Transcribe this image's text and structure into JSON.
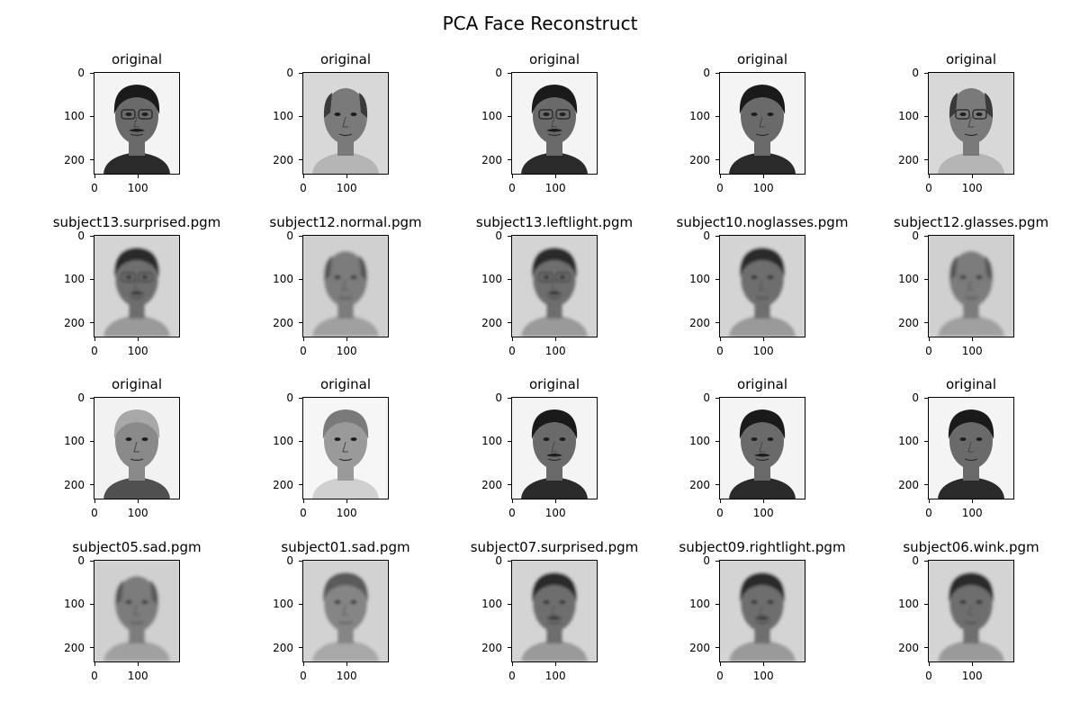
{
  "suptitle": "PCA Face Reconstruct",
  "chart_data": {
    "type": "image-grid",
    "title": "PCA Face Reconstruct",
    "rows": 4,
    "cols": 5,
    "x_ticks": [
      "0",
      "100"
    ],
    "y_ticks": [
      "0",
      "100",
      "200"
    ],
    "xlim": [
      0,
      195
    ],
    "ylim": [
      0,
      231
    ],
    "panels": [
      {
        "title": "original",
        "tone": "dark",
        "glasses": true,
        "mustache": true
      },
      {
        "title": "original",
        "tone": "bald",
        "glasses": false,
        "mustache": false
      },
      {
        "title": "original",
        "tone": "dark",
        "glasses": true,
        "mustache": true
      },
      {
        "title": "original",
        "tone": "dark",
        "glasses": false,
        "mustache": false
      },
      {
        "title": "original",
        "tone": "bald",
        "glasses": true,
        "mustache": false
      },
      {
        "title": "subject13.surprised.pgm",
        "tone": "recon-dark",
        "glasses": true,
        "mustache": true
      },
      {
        "title": "subject12.normal.pgm",
        "tone": "recon-bald",
        "glasses": false,
        "mustache": false
      },
      {
        "title": "subject13.leftlight.pgm",
        "tone": "recon-dark",
        "glasses": true,
        "mustache": true
      },
      {
        "title": "subject10.noglasses.pgm",
        "tone": "recon-dark",
        "glasses": false,
        "mustache": false
      },
      {
        "title": "subject12.glasses.pgm",
        "tone": "recon-bald",
        "glasses": false,
        "mustache": false
      },
      {
        "title": "original",
        "tone": "gray",
        "glasses": false,
        "mustache": false
      },
      {
        "title": "original",
        "tone": "light",
        "glasses": false,
        "mustache": false
      },
      {
        "title": "original",
        "tone": "dark",
        "glasses": false,
        "mustache": true
      },
      {
        "title": "original",
        "tone": "dark",
        "glasses": false,
        "mustache": true
      },
      {
        "title": "original",
        "tone": "dark",
        "glasses": false,
        "mustache": false
      },
      {
        "title": "subject05.sad.pgm",
        "tone": "recon-bald",
        "glasses": false,
        "mustache": false
      },
      {
        "title": "subject01.sad.pgm",
        "tone": "recon-light",
        "glasses": false,
        "mustache": false
      },
      {
        "title": "subject07.surprised.pgm",
        "tone": "recon-dark",
        "glasses": false,
        "mustache": true
      },
      {
        "title": "subject09.rightlight.pgm",
        "tone": "recon-dark",
        "glasses": false,
        "mustache": true
      },
      {
        "title": "subject06.wink.pgm",
        "tone": "recon-dark",
        "glasses": false,
        "mustache": false
      }
    ]
  }
}
